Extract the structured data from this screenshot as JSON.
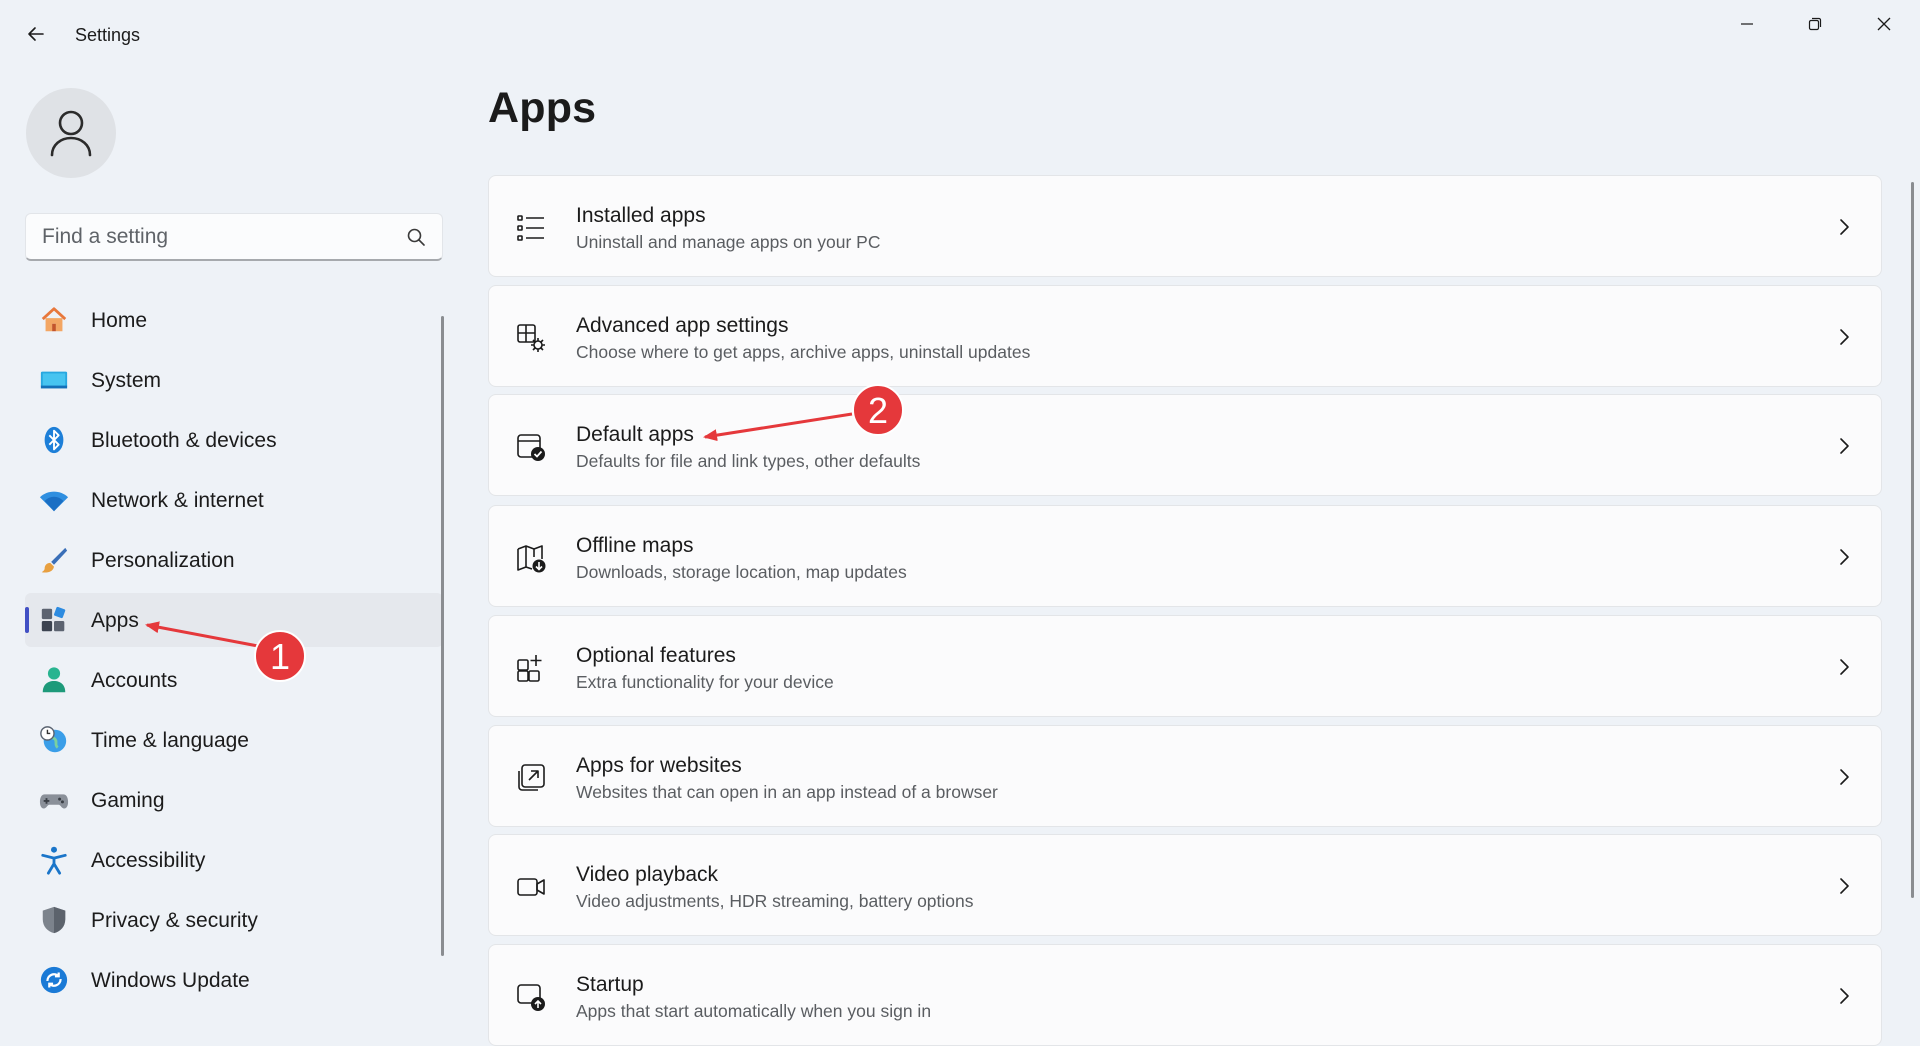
{
  "window": {
    "title": "Settings",
    "back_icon": "back-arrow-icon",
    "controls": [
      "minimize-icon",
      "restore-icon",
      "close-icon"
    ]
  },
  "user": {
    "avatar_icon": "person-icon"
  },
  "search": {
    "placeholder": "Find a setting",
    "value": ""
  },
  "sidebar": {
    "items": [
      {
        "label": "Home",
        "icon": "home-icon"
      },
      {
        "label": "System",
        "icon": "system-icon"
      },
      {
        "label": "Bluetooth & devices",
        "icon": "bluetooth-icon"
      },
      {
        "label": "Network & internet",
        "icon": "wifi-icon"
      },
      {
        "label": "Personalization",
        "icon": "brush-icon"
      },
      {
        "label": "Apps",
        "icon": "apps-icon",
        "selected": true
      },
      {
        "label": "Accounts",
        "icon": "accounts-icon"
      },
      {
        "label": "Time & language",
        "icon": "time-language-icon"
      },
      {
        "label": "Gaming",
        "icon": "gamepad-icon"
      },
      {
        "label": "Accessibility",
        "icon": "accessibility-icon"
      },
      {
        "label": "Privacy & security",
        "icon": "shield-icon"
      },
      {
        "label": "Windows Update",
        "icon": "windows-update-icon"
      }
    ]
  },
  "main": {
    "title": "Apps",
    "cards": [
      {
        "title": "Installed apps",
        "subtitle": "Uninstall and manage apps on your PC",
        "icon": "list-icon"
      },
      {
        "title": "Advanced app settings",
        "subtitle": "Choose where to get apps, archive apps, uninstall updates",
        "icon": "app-settings-icon"
      },
      {
        "title": "Default apps",
        "subtitle": "Defaults for file and link types, other defaults",
        "icon": "default-apps-icon"
      },
      {
        "title": "Offline maps",
        "subtitle": "Downloads, storage location, map updates",
        "icon": "map-icon"
      },
      {
        "title": "Optional features",
        "subtitle": "Extra functionality for your device",
        "icon": "optional-features-icon"
      },
      {
        "title": "Apps for websites",
        "subtitle": "Websites that can open in an app instead of a browser",
        "icon": "open-in-app-icon"
      },
      {
        "title": "Video playback",
        "subtitle": "Video adjustments, HDR streaming, battery options",
        "icon": "video-icon"
      },
      {
        "title": "Startup",
        "subtitle": "Apps that start automatically when you sign in",
        "icon": "startup-icon"
      }
    ]
  },
  "annotations": [
    {
      "number": "1",
      "points_to": "Apps"
    },
    {
      "number": "2",
      "points_to": "Default apps"
    }
  ],
  "colors": {
    "accent": "#4150c4",
    "annotation": "#e5383b",
    "background": "#eef2f7",
    "card": "#fbfbfc"
  }
}
